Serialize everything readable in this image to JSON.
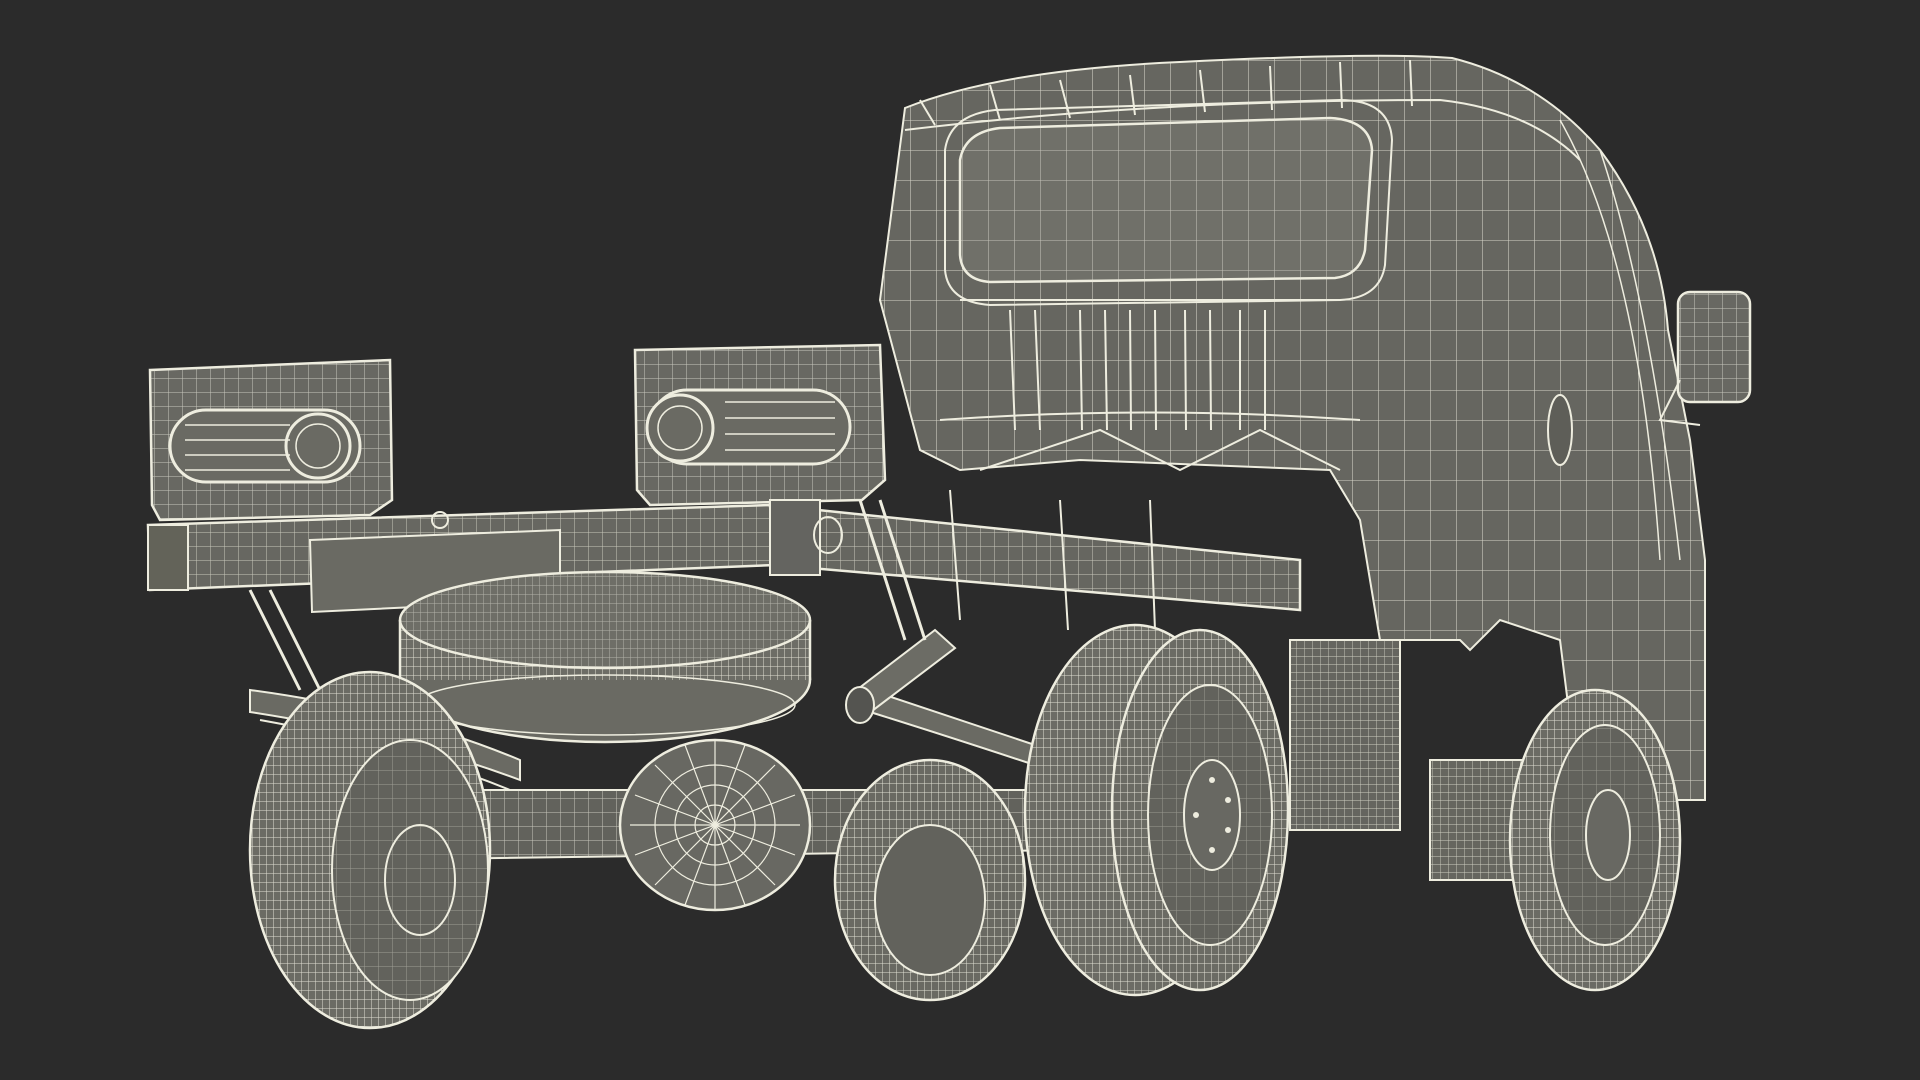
{
  "scene": {
    "background": "#2b2b2b",
    "surface_fill": "#6e6e64",
    "surface_fill_dark": "#5f5f57",
    "wire_color": "#e9e8da",
    "shadow_wire_color": "#cfcdbf",
    "subject": "truck-chassis-wireframe"
  }
}
